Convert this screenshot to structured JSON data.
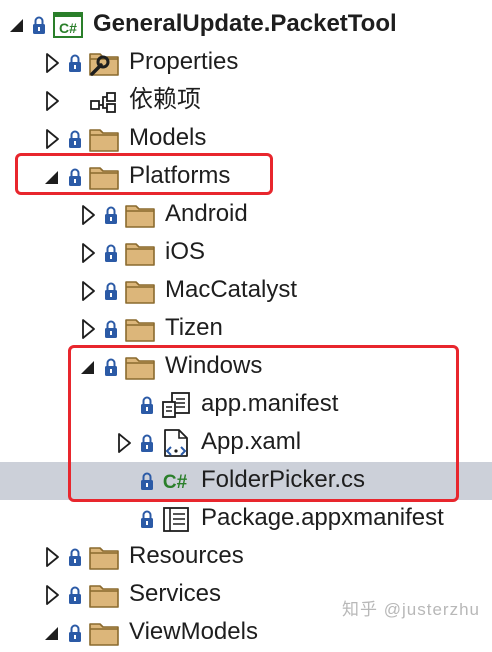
{
  "colors": {
    "highlight_box": "#e8262d",
    "selected_row": "#ccd0d9",
    "folder_fill": "#dcb67a",
    "folder_stroke": "#8a6a2e",
    "lock": "#2b5aa6",
    "csharp": "#2a7f2a"
  },
  "tree": {
    "project": {
      "label": "GeneralUpdate.PacketTool",
      "icon": "csharp-project-icon"
    },
    "properties": {
      "label": "Properties",
      "icon": "properties-folder-icon"
    },
    "dependencies": {
      "label": "依赖项",
      "icon": "dependencies-icon"
    },
    "models": {
      "label": "Models",
      "icon": "folder-icon"
    },
    "platforms": {
      "label": "Platforms",
      "icon": "folder-icon",
      "children": {
        "android": {
          "label": "Android"
        },
        "ios": {
          "label": "iOS"
        },
        "maccatalyst": {
          "label": "MacCatalyst"
        },
        "tizen": {
          "label": "Tizen"
        },
        "windows": {
          "label": "Windows",
          "children": {
            "app_manifest": {
              "label": "app.manifest",
              "icon": "manifest-file-icon"
            },
            "app_xaml": {
              "label": "App.xaml",
              "icon": "xaml-file-icon"
            },
            "folder_picker": {
              "label": "FolderPicker.cs",
              "icon": "csharp-file-icon",
              "selected": true
            },
            "package_manifest": {
              "label": "Package.appxmanifest",
              "icon": "appx-manifest-icon"
            }
          }
        }
      }
    },
    "resources": {
      "label": "Resources",
      "icon": "folder-icon"
    },
    "services": {
      "label": "Services",
      "icon": "folder-icon"
    },
    "viewmodels": {
      "label": "ViewModels",
      "icon": "folder-icon"
    }
  },
  "watermark": "知乎 @justerzhu"
}
